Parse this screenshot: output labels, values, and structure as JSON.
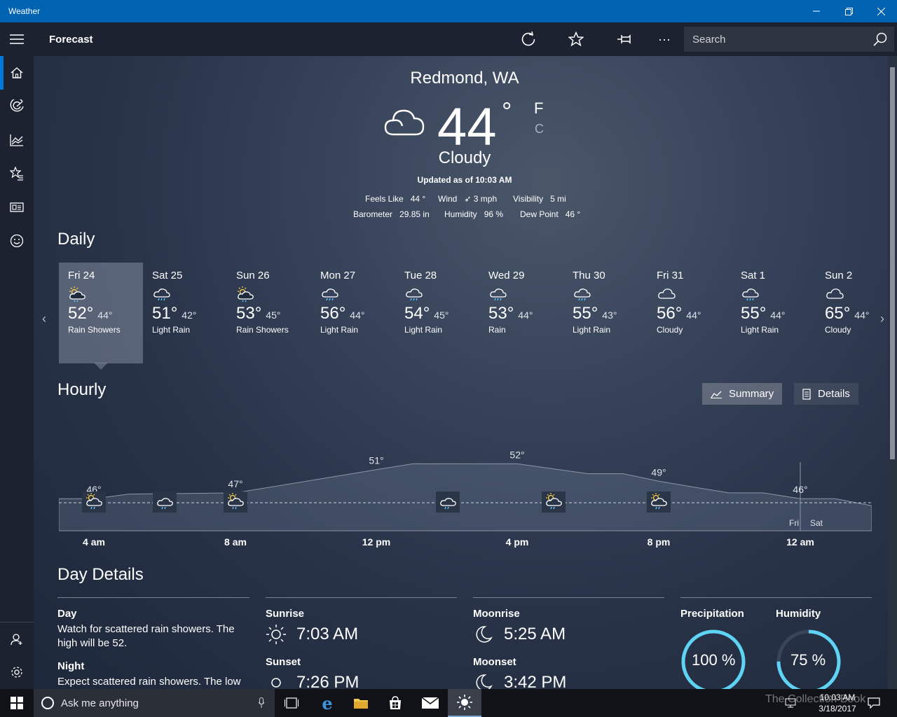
{
  "window": {
    "title": "Weather"
  },
  "appbar": {
    "heading": "Forecast",
    "search_placeholder": "Search"
  },
  "current": {
    "location": "Redmond, WA",
    "temp": "44",
    "degree": "°",
    "unit_f": "F",
    "unit_c": "C",
    "condition": "Cloudy",
    "updated": "Updated as of 10:03 AM",
    "stats": [
      {
        "label": "Feels Like",
        "value": "44 °"
      },
      {
        "label": "Wind",
        "value": "3 mph"
      },
      {
        "label": "Visibility",
        "value": "5 mi"
      },
      {
        "label": "Barometer",
        "value": "29.85 in"
      },
      {
        "label": "Humidity",
        "value": "96 %"
      },
      {
        "label": "Dew Point",
        "value": "46 °"
      }
    ]
  },
  "daily": {
    "title": "Daily",
    "days": [
      {
        "name": "Fri 24",
        "hi": "52°",
        "lo": "44°",
        "cond": "Rain Showers",
        "icon": "sun-rain"
      },
      {
        "name": "Sat 25",
        "hi": "51°",
        "lo": "42°",
        "cond": "Light Rain",
        "icon": "rain"
      },
      {
        "name": "Sun 26",
        "hi": "53°",
        "lo": "45°",
        "cond": "Rain Showers",
        "icon": "sun-rain"
      },
      {
        "name": "Mon 27",
        "hi": "56°",
        "lo": "44°",
        "cond": "Light Rain",
        "icon": "rain"
      },
      {
        "name": "Tue 28",
        "hi": "54°",
        "lo": "45°",
        "cond": "Light Rain",
        "icon": "rain"
      },
      {
        "name": "Wed 29",
        "hi": "53°",
        "lo": "44°",
        "cond": "Rain",
        "icon": "rain"
      },
      {
        "name": "Thu 30",
        "hi": "55°",
        "lo": "43°",
        "cond": "Light Rain",
        "icon": "rain"
      },
      {
        "name": "Fri 31",
        "hi": "56°",
        "lo": "44°",
        "cond": "Cloudy",
        "icon": "cloud"
      },
      {
        "name": "Sat 1",
        "hi": "55°",
        "lo": "44°",
        "cond": "Light Rain",
        "icon": "rain"
      },
      {
        "name": "Sun 2",
        "hi": "65°",
        "lo": "44°",
        "cond": "Cloudy",
        "icon": "cloud"
      }
    ]
  },
  "hourly": {
    "title": "Hourly",
    "summary_label": "Summary",
    "details_label": "Details",
    "temps": [
      {
        "label": "46°",
        "value": 46
      },
      {
        "label": "47°",
        "value": 47
      },
      {
        "label": "51°",
        "value": 51
      },
      {
        "label": "52°",
        "value": 52
      },
      {
        "label": "49°",
        "value": 49
      },
      {
        "label": "46°",
        "value": 46
      }
    ],
    "hours": [
      "4 am",
      "8 am",
      "12 pm",
      "4 pm",
      "8 pm",
      "12 am"
    ],
    "day_split": [
      "Fri",
      "Sat"
    ]
  },
  "details": {
    "title": "Day Details",
    "day_label": "Day",
    "day_text": "Watch for scattered rain showers. The high will be 52.",
    "night_label": "Night",
    "night_text": "Expect scattered rain showers. The low",
    "sunrise_label": "Sunrise",
    "sunrise": "7:03 AM",
    "sunset_label": "Sunset",
    "sunset": "7:26 PM",
    "moonrise_label": "Moonrise",
    "moonrise": "5:25 AM",
    "moonset_label": "Moonset",
    "moonset": "3:42 PM",
    "precip_label": "Precipitation",
    "precip": "100 %",
    "precip_value": 100,
    "humidity_label": "Humidity",
    "humidity": "75 %",
    "humidity_value": 75
  },
  "taskbar": {
    "cortana_placeholder": "Ask me anything",
    "time": "10:03 AM",
    "date": "3/18/2017",
    "watermark": "The Collection Book"
  },
  "colors": {
    "accent": "#0078d7",
    "ring": "#5ed3f3",
    "titlebar": "#0063b1"
  }
}
